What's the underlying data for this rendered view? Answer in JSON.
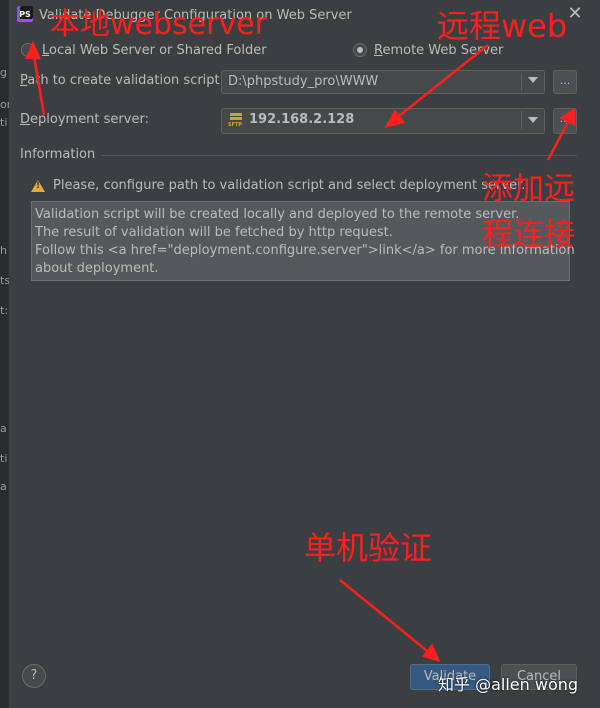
{
  "dialog": {
    "title": "Validate Debugger Configuration on Web Server",
    "close": "✕",
    "app_icon": "PS"
  },
  "mode": {
    "local_prefix": "L",
    "local_rest": "ocal Web Server or Shared Folder",
    "remote_prefix": "R",
    "remote_rest": "emote Web Server",
    "selected": "remote"
  },
  "path": {
    "label_prefix": "P",
    "label_rest": "ath to create validation script:",
    "value": "D:\\phpstudy_pro\\WWW",
    "browse": "..."
  },
  "deployment": {
    "label_prefix": "D",
    "label_rest": "eployment server:",
    "server_icon_text": "SFTP",
    "value": "192.168.2.128",
    "browse": "..."
  },
  "information": {
    "section_title": "Information",
    "warning": "Please, configure path to validation script and select deployment server.",
    "lines": [
      "Validation script will be created locally and deployed to the remote server.",
      "The result of validation will be fetched by http request.",
      "Follow this <a href=\"deployment.configure.server\">link</a> for more information",
      "about deployment."
    ]
  },
  "footer": {
    "help": "?",
    "validate_label": "Validate",
    "cancel_label": "Cancel"
  },
  "left_strip": [
    "g",
    "or",
    "ti",
    "h",
    "ts",
    "t:",
    "a",
    "ti",
    "a"
  ],
  "annotations": {
    "local": "本地webserver",
    "remote": "远程web",
    "add_line1": "添加远",
    "add_line2": "程连接",
    "validate": "单机验证",
    "color": "#ff1f1f"
  },
  "watermark": "知乎 @allen wong"
}
